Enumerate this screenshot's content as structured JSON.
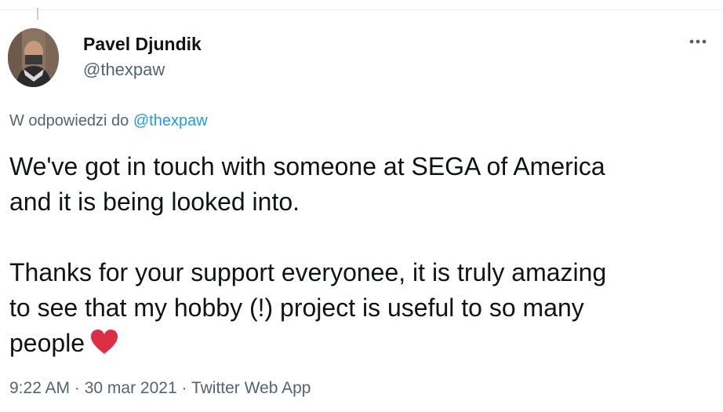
{
  "tweet": {
    "author": {
      "name": "Pavel Djundik",
      "handle": "@thexpaw"
    },
    "reply_context": {
      "prefix": "W odpowiedzi do",
      "mention": "@thexpaw"
    },
    "text": {
      "line1": "We've got in touch with someone at SEGA of America",
      "line2": "and it is being looked into.",
      "line3": "Thanks for your support everyonee, it is truly amazing",
      "line4": "to see that my hobby (!) project is useful to so many",
      "line5": "people"
    },
    "meta": {
      "time": "9:22 AM",
      "separator1": " · ",
      "date": "30 mar 2021",
      "separator2": " · ",
      "source": "Twitter Web App"
    }
  },
  "colors": {
    "primary_text": "#0f1419",
    "secondary_text": "#536471",
    "link": "#1d9bf0",
    "heart": "#dd2e44",
    "border": "#eff3f4"
  },
  "icons": {
    "more": "more-horizontal-icon",
    "heart": "red-heart-emoji"
  }
}
